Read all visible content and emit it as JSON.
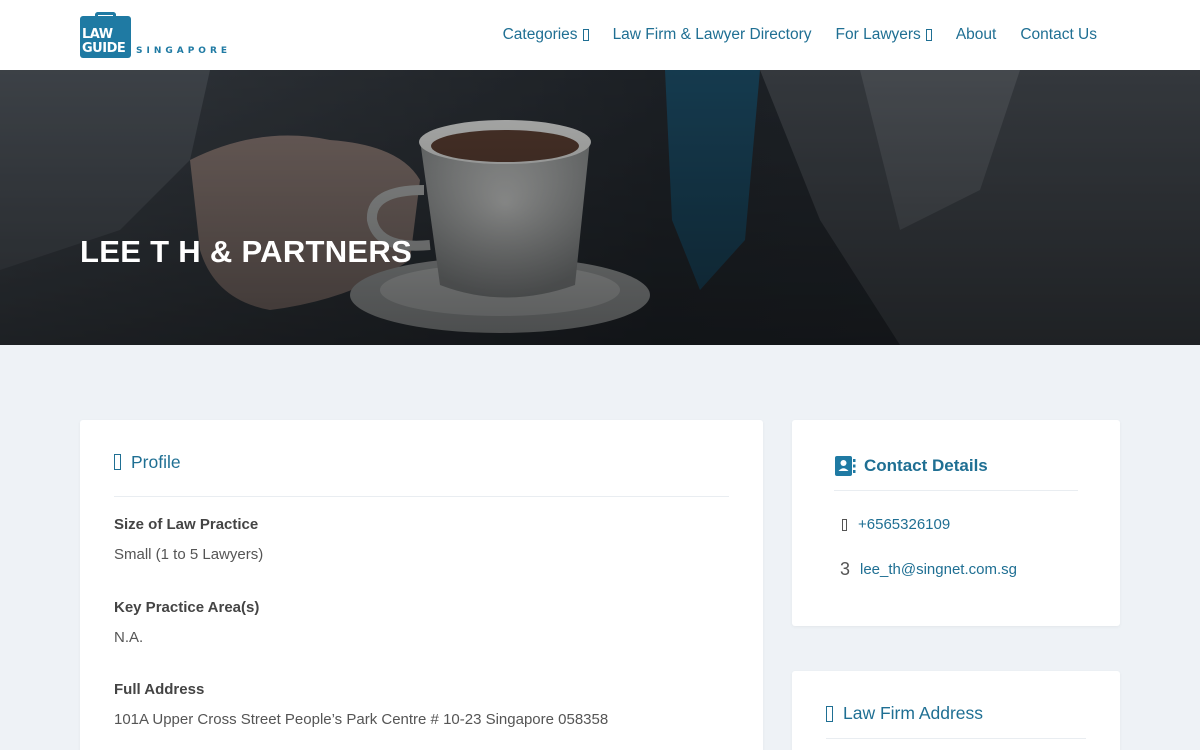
{
  "logo": {
    "line1": "LAW",
    "line2": "GUIDE",
    "sub": "SINGAPORE"
  },
  "nav": {
    "items": [
      {
        "label": "Categories",
        "dropdown": true
      },
      {
        "label": "Law Firm & Lawyer Directory",
        "dropdown": false
      },
      {
        "label": "For Lawyers",
        "dropdown": true
      },
      {
        "label": "About",
        "dropdown": false
      },
      {
        "label": "Contact Us",
        "dropdown": false
      }
    ]
  },
  "hero": {
    "title": "LEE T H & PARTNERS"
  },
  "profile": {
    "heading": "Profile",
    "fields": [
      {
        "label": "Size of Law Practice",
        "value": "Small (1 to 5 Lawyers)"
      },
      {
        "label": "Key Practice Area(s)",
        "value": "N.A."
      },
      {
        "label": "Full Address",
        "value": "101A Upper Cross Street People’s Park Centre # 10-23 Singapore 058358"
      }
    ]
  },
  "contact": {
    "heading": "Contact Details",
    "phone": "+6565326109",
    "email": "lee_th@singnet.com.sg",
    "email_icon_glyph": "3"
  },
  "address": {
    "heading": "Law Firm Address"
  },
  "colors": {
    "brand": "#1f7aa3",
    "link": "#1f6f93",
    "page_bg": "#eef2f6"
  }
}
